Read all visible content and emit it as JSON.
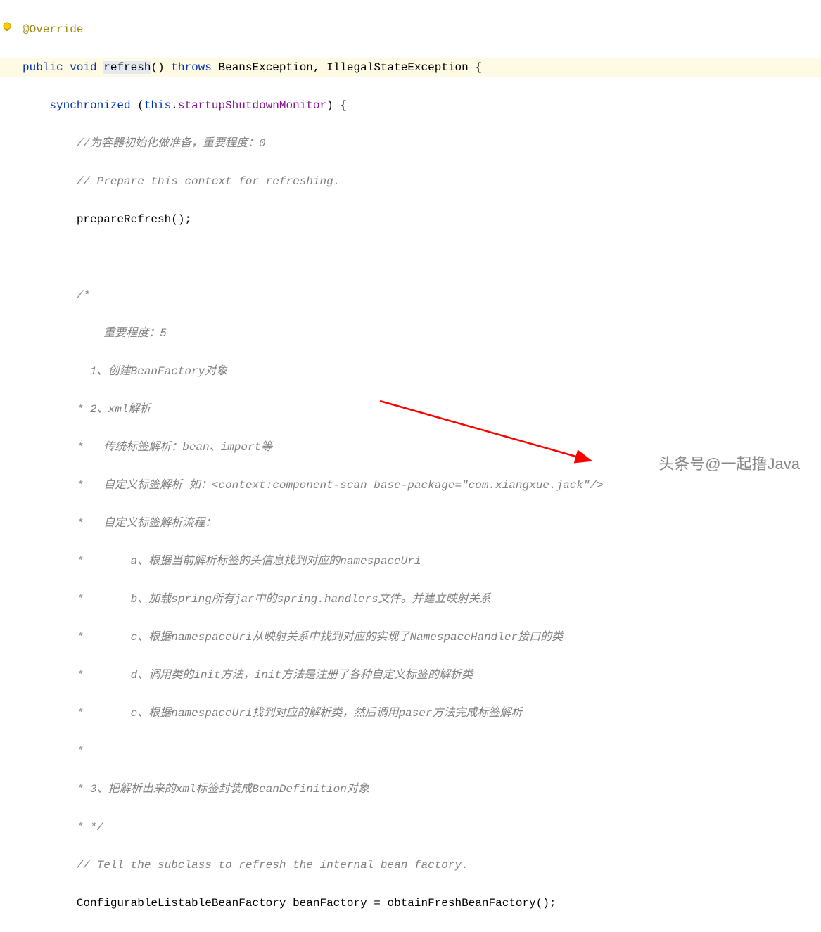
{
  "code": {
    "annotation": "@Override",
    "kw_public": "public",
    "kw_void": "void",
    "method_refresh": "refresh",
    "parens": "()",
    "kw_throws": "throws",
    "exceptions": "BeansException, IllegalStateException {",
    "kw_synchronized": "synchronized",
    "paren_open": "(",
    "kw_this": "this",
    "dot": ".",
    "field_monitor": "startupShutdownMonitor",
    "paren_close_brace": ") {",
    "comment1": "//为容器初始化做准备，重要程度：0",
    "comment2": "// Prepare this context for refreshing.",
    "call_prepare": "prepareRefresh();",
    "comment_block_start": "/*",
    "comment_l1": "    重要程度：5",
    "comment_l2": "  1、创建BeanFactory对象",
    "comment_l3": "* 2、xml解析",
    "comment_l4": "*   传统标签解析：bean、import等",
    "comment_l5": "*   自定义标签解析 如：<context:component-scan base-package=\"com.xiangxue.jack\"/>",
    "comment_l6": "*   自定义标签解析流程：",
    "comment_l7": "*       a、根据当前解析标签的头信息找到对应的namespaceUri",
    "comment_l8": "*       b、加载spring所有jar中的spring.handlers文件。并建立映射关系",
    "comment_l9": "*       c、根据namespaceUri从映射关系中找到对应的实现了NamespaceHandler接口的类",
    "comment_l10": "*       d、调用类的init方法，init方法是注册了各种自定义标签的解析类",
    "comment_l11": "*       e、根据namespaceUri找到对应的解析类，然后调用paser方法完成标签解析",
    "comment_l12": "*",
    "comment_l13": "* 3、把解析出来的xml标签封装成BeanDefinition对象",
    "comment_block_end": "* */",
    "comment3": "// Tell the subclass to refresh the internal bean factory.",
    "last_line_type": "ConfigurableListableBeanFactory beanFactory = ",
    "last_line_call": "obtainFreshBeanFactory();"
  },
  "watermark": "头条号@一起撸Java",
  "colors": {
    "keyword": "#0033b3",
    "comment": "#808080",
    "field": "#871094",
    "annotation": "#9e880d",
    "arrow": "#ff0000"
  }
}
